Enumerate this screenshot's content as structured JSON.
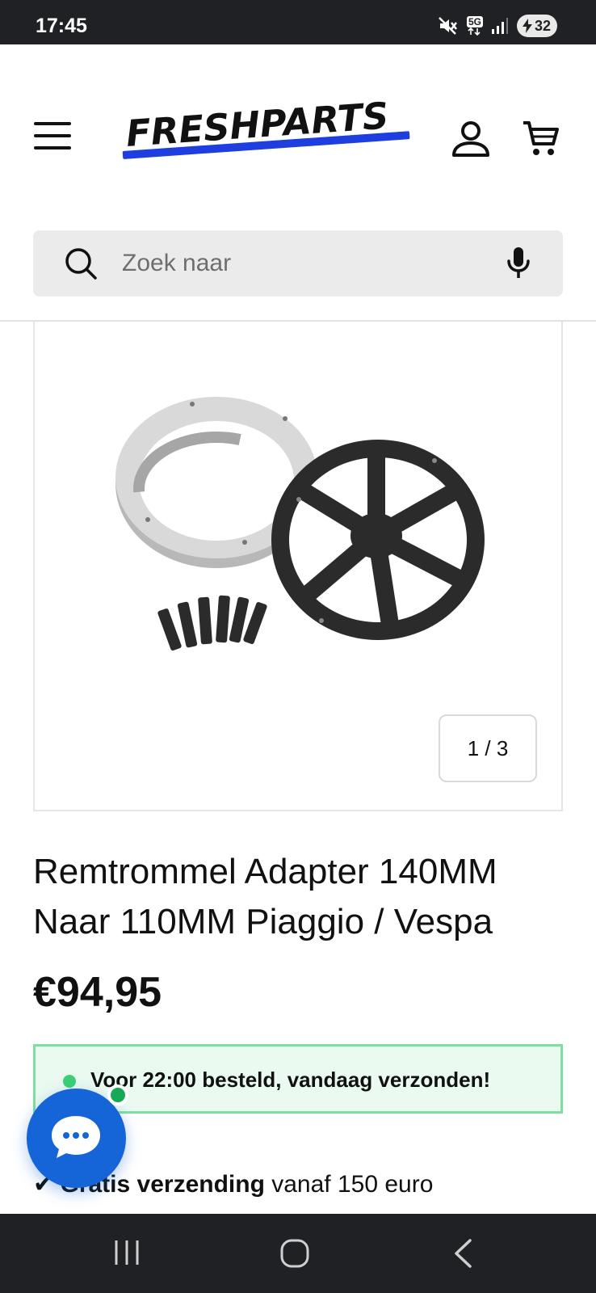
{
  "status_bar": {
    "time": "17:45",
    "network": "5G",
    "battery": "32",
    "icons": [
      "mute-icon",
      "5g-icon",
      "signal-icon",
      "battery-charging-icon"
    ]
  },
  "header": {
    "logo_text": "FRESHPARTS",
    "brand_color": "#1f3ee0",
    "icons": [
      "menu-icon",
      "account-icon",
      "cart-icon"
    ]
  },
  "search": {
    "placeholder": "Zoek naar",
    "icons": [
      "search-icon",
      "microphone-icon"
    ]
  },
  "gallery": {
    "counter": "1 / 3"
  },
  "product": {
    "title": "Remtrommel Adapter 140MM Naar 110MM Piaggio / Vespa",
    "price": "€94,95"
  },
  "notice": {
    "text": "Voor 22:00 besteld, vandaag verzonden!",
    "color": "#3ccf76"
  },
  "shipping": {
    "check": "✔",
    "bold": "Gratis verzending",
    "rest": " vanaf 150 euro"
  },
  "chat": {
    "color": "#1565d8",
    "icon": "chat-bubble-icon"
  },
  "nav_bar": {
    "icons": [
      "recent-apps-icon",
      "home-icon",
      "back-icon"
    ]
  }
}
